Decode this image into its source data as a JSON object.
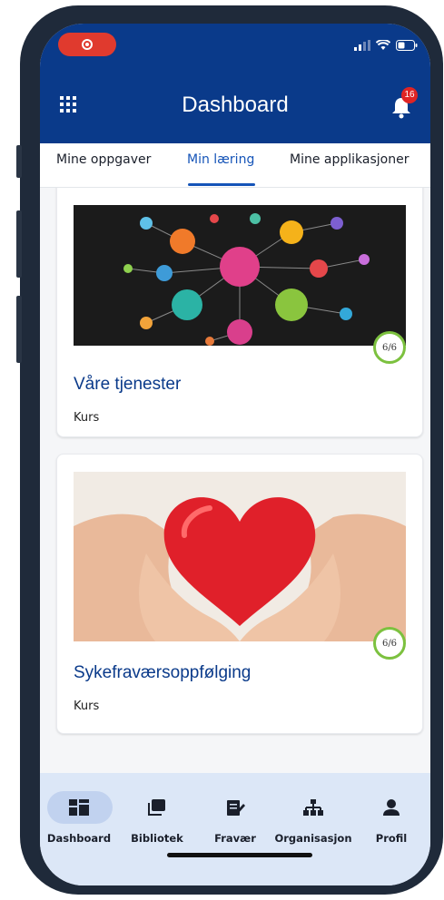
{
  "header": {
    "title": "Dashboard",
    "notification_count": "16"
  },
  "tabs": [
    {
      "label": "Mine oppgaver"
    },
    {
      "label": "Min læring"
    },
    {
      "label": "Mine applikasjoner"
    }
  ],
  "active_tab": "Min læring",
  "courses": [
    {
      "title": "Våre tjenester",
      "type": "Kurs",
      "progress": "6/6",
      "image": "network-services-illustration"
    },
    {
      "title": "Sykefraværsoppfølging",
      "type": "Kurs",
      "progress": "6/6",
      "image": "hands-holding-heart-photo"
    }
  ],
  "bottom_nav": [
    {
      "label": "Dashboard",
      "icon": "dashboard-icon",
      "active": true
    },
    {
      "label": "Bibliotek",
      "icon": "library-icon",
      "active": false
    },
    {
      "label": "Fravær",
      "icon": "absence-icon",
      "active": false
    },
    {
      "label": "Organisasjon",
      "icon": "organization-icon",
      "active": false
    },
    {
      "label": "Profil",
      "icon": "profile-icon",
      "active": false
    }
  ],
  "colors": {
    "primary": "#0a3a8a",
    "accent": "#1554b8",
    "progress": "#7cc13f",
    "badge": "#e02424",
    "nav_bg": "#dce7f7"
  }
}
